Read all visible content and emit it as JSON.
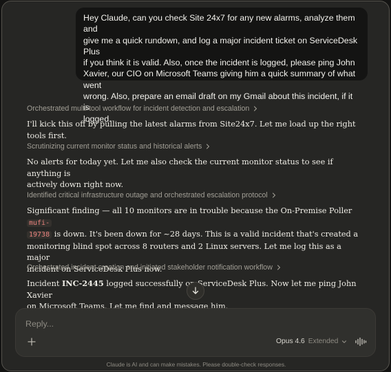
{
  "user_message": {
    "lines": [
      "Hey Claude, can you check Site 24x7 for any new alarms, analyze them and",
      "give me a quick rundown, and log a major incident ticket on ServiceDesk Plus",
      "if you think it is valid. Also, once the incident is logged, please ping John",
      "Xavier, our CIO on Microsoft Teams giving him a quick summary of what went",
      "wrong. Also, prepare an email draft on my Gmail about this incident, if it is",
      "logged."
    ]
  },
  "steps": [
    {
      "label": "Orchestrated multi-tool workflow for incident detection and escalation"
    },
    {
      "label": "Scrutinizing current monitor status and historical alerts"
    },
    {
      "label": "Identified critical infrastructure outage and orchestrated escalation protocol"
    },
    {
      "label": "Orchestrated incident creation and initiated stakeholder notification workflow"
    }
  ],
  "responses": {
    "r1": {
      "line1": "I'll kick this off by pulling the latest alarms from Site24x7. Let me load up the right tools first."
    },
    "r2": {
      "line1": "No alerts for today yet. Let me also check the current monitor status to see if anything is",
      "line2": "actively down right now."
    },
    "r3": {
      "line1_pre": "Significant finding — all 10 monitors are in trouble because the On-Premise Poller ",
      "code_part1": "mufi-",
      "code_part2": "19738",
      "line2_post": " is down. It's been down for ~28 days. This is a valid incident that's created a",
      "line3": "monitoring blind spot across 8 routers and 2 Linux servers. Let me log this as a major",
      "line4": "incident on ServiceDesk Plus now."
    },
    "r4": {
      "line1_pre": "Incident ",
      "incident_id": "INC-2445",
      "line1_post": " logged successfully on ServiceDesk Plus. Now let me ping John Xavier",
      "line2": "on Microsoft Teams. Let me find and message him."
    }
  },
  "composer": {
    "placeholder": "Reply...",
    "model_name": "Opus 4.6",
    "mode_label": "Extended"
  },
  "icons": {
    "step_chevron": "chevron-right-icon",
    "scroll": "arrow-down-icon",
    "attach": "plus-icon",
    "mode_dropdown": "chevron-down-icon",
    "voice": "voice-waveform-icon"
  },
  "colors": {
    "background": "#262624",
    "user_bubble": "#141413",
    "inline_code": "#e8837e",
    "composer": "#30302d"
  },
  "disclaimer": "Claude is AI and can make mistakes. Please double-check responses."
}
